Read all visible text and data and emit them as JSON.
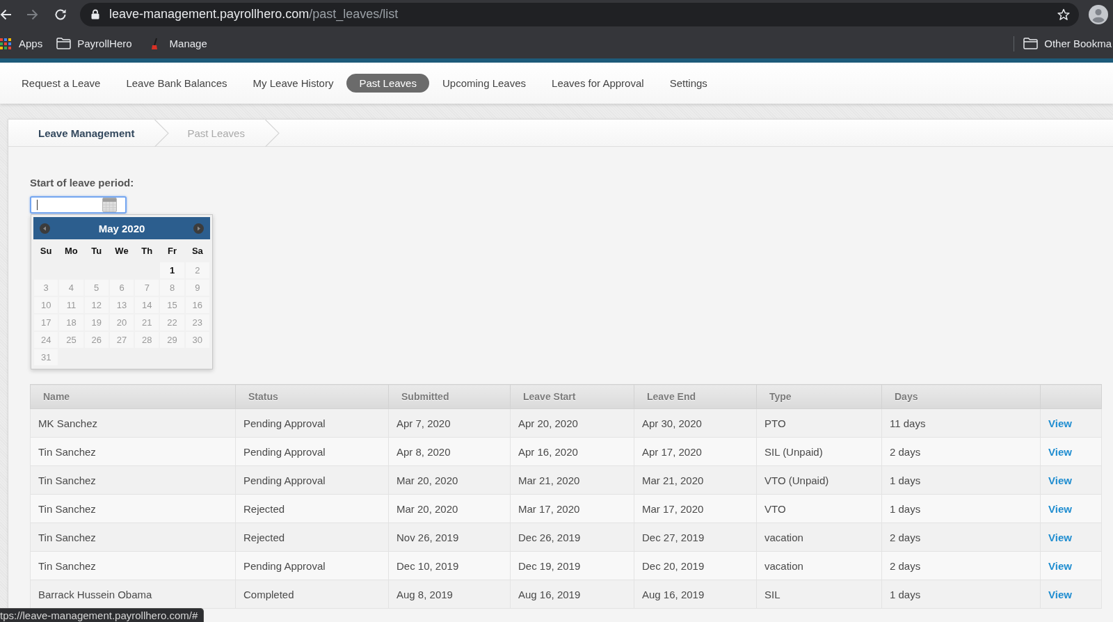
{
  "browser": {
    "navigation": {
      "back_disabled": false,
      "forward_disabled": true
    },
    "url": {
      "host": "leave-management.payrollhero.com",
      "path": "/past_leaves/list"
    },
    "bookmarks": [
      {
        "kind": "apps",
        "label": "Apps"
      },
      {
        "kind": "folder",
        "label": "PayrollHero"
      },
      {
        "kind": "favicon",
        "label": "Manage"
      }
    ],
    "other_bookmarks": {
      "kind": "folder",
      "label": "Other Bookma"
    }
  },
  "nav": {
    "tabs": [
      {
        "label": "Request a Leave",
        "selected": false
      },
      {
        "label": "Leave Bank Balances",
        "selected": false
      },
      {
        "label": "My Leave History",
        "selected": false
      },
      {
        "label": "Past Leaves",
        "selected": true
      },
      {
        "label": "Upcoming Leaves",
        "selected": false
      },
      {
        "label": "Leaves for Approval",
        "selected": false
      },
      {
        "label": "Settings",
        "selected": false
      }
    ]
  },
  "breadcrumb": [
    {
      "label": "Leave Management",
      "current": false
    },
    {
      "label": "Past Leaves",
      "current": true
    }
  ],
  "filter": {
    "label": "Start of leave period:",
    "date_input": {
      "focused": true
    }
  },
  "datepicker": {
    "title": "May 2020",
    "weekdays": [
      "Su",
      "Mo",
      "Tu",
      "We",
      "Th",
      "Fr",
      "Sa"
    ],
    "weeks": [
      [
        {
          "label": "1",
          "disabled": false
        },
        {
          "label": "2",
          "disabled": true
        }
      ],
      [
        {
          "label": "3",
          "disabled": true
        },
        {
          "label": "4",
          "disabled": true
        },
        {
          "label": "5",
          "disabled": true
        },
        {
          "label": "6",
          "disabled": true
        },
        {
          "label": "7",
          "disabled": true
        },
        {
          "label": "8",
          "disabled": true
        },
        {
          "label": "9",
          "disabled": true
        }
      ],
      [
        {
          "label": "10",
          "disabled": true
        },
        {
          "label": "11",
          "disabled": true
        },
        {
          "label": "12",
          "disabled": true
        },
        {
          "label": "13",
          "disabled": true
        },
        {
          "label": "14",
          "disabled": true
        },
        {
          "label": "15",
          "disabled": true
        },
        {
          "label": "16",
          "disabled": true
        }
      ],
      [
        {
          "label": "17",
          "disabled": true
        },
        {
          "label": "18",
          "disabled": true
        },
        {
          "label": "19",
          "disabled": true
        },
        {
          "label": "20",
          "disabled": true
        },
        {
          "label": "21",
          "disabled": true
        },
        {
          "label": "22",
          "disabled": true
        },
        {
          "label": "23",
          "disabled": true
        }
      ],
      [
        {
          "label": "24",
          "disabled": true
        },
        {
          "label": "25",
          "disabled": true
        },
        {
          "label": "26",
          "disabled": true
        },
        {
          "label": "27",
          "disabled": true
        },
        {
          "label": "28",
          "disabled": true
        },
        {
          "label": "29",
          "disabled": true
        },
        {
          "label": "30",
          "disabled": true
        }
      ],
      [
        {
          "label": "31",
          "disabled": true
        }
      ]
    ]
  },
  "table": {
    "columns": [
      "Name",
      "Status",
      "Submitted",
      "Leave Start",
      "Leave End",
      "Type",
      "Days"
    ],
    "rows": [
      {
        "cells": [
          "MK Sanchez",
          "Pending Approval",
          "Apr 7, 2020",
          "Apr 20, 2020",
          "Apr 30, 2020",
          "PTO",
          "11 days"
        ],
        "action": "View"
      },
      {
        "cells": [
          "Tin Sanchez",
          "Pending Approval",
          "Apr 8, 2020",
          "Apr 16, 2020",
          "Apr 17, 2020",
          "SIL (Unpaid)",
          "2 days"
        ],
        "action": "View"
      },
      {
        "cells": [
          "Tin Sanchez",
          "Pending Approval",
          "Mar 20, 2020",
          "Mar 21, 2020",
          "Mar 21, 2020",
          "VTO (Unpaid)",
          "1 days"
        ],
        "action": "View"
      },
      {
        "cells": [
          "Tin Sanchez",
          "Rejected",
          "Mar 20, 2020",
          "Mar 17, 2020",
          "Mar 17, 2020",
          "VTO",
          "1 days"
        ],
        "action": "View"
      },
      {
        "cells": [
          "Tin Sanchez",
          "Rejected",
          "Nov 26, 2019",
          "Dec 26, 2019",
          "Dec 27, 2019",
          "vacation",
          "2 days"
        ],
        "action": "View"
      },
      {
        "cells": [
          "Tin Sanchez",
          "Pending Approval",
          "Dec 10, 2019",
          "Dec 19, 2019",
          "Dec 20, 2019",
          "vacation",
          "2 days"
        ],
        "action": "View"
      },
      {
        "cells": [
          "Barrack Hussein Obama",
          "Completed",
          "Aug 8, 2019",
          "Aug 16, 2019",
          "Aug 16, 2019",
          "SIL",
          "1 days"
        ],
        "action": "View"
      }
    ]
  },
  "status_bar": {
    "url": "tps://leave-management.payrollhero.com/#"
  }
}
